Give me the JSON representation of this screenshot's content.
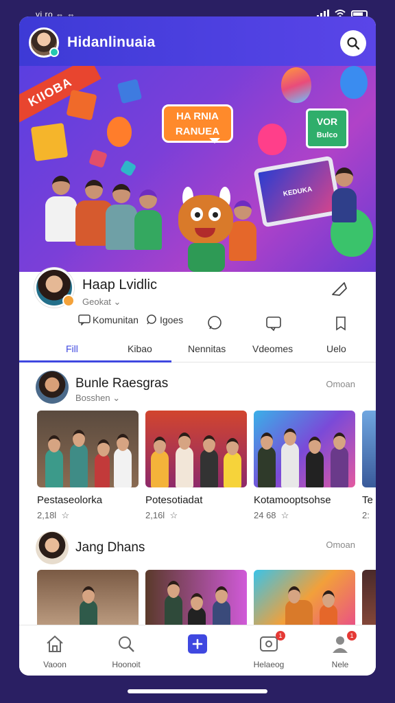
{
  "status": {
    "time": "vi ro ⇔ ⇔"
  },
  "header": {
    "title": "Hidanlinuaia"
  },
  "banner": {
    "ribbon": "KIIOBA",
    "speech_line1": "HA RNIA",
    "speech_line2": "RANUEA",
    "board_line1": "VOR",
    "board_line2": "Bulco",
    "screen": "KEDUKA"
  },
  "profile": {
    "name": "Haap Lvidlic",
    "subtitle": "Geokat",
    "actions": [
      {
        "label": "Komunitan"
      },
      {
        "label": "Igoes"
      }
    ]
  },
  "tabs": [
    {
      "label": "Fill",
      "active": true
    },
    {
      "label": "Kibao",
      "active": false
    },
    {
      "label": "Nennitas",
      "active": false
    },
    {
      "label": "Vdeomes",
      "active": false
    },
    {
      "label": "Uelo",
      "active": false
    }
  ],
  "section1": {
    "title": "Bunle Raesgras",
    "subtitle": "Bosshen",
    "more": "Omoan",
    "cards": [
      {
        "title": "Pestaseolorka",
        "meta": "2,18l",
        "rating": "☆"
      },
      {
        "title": "Potesotiadat",
        "meta": "2,16l",
        "rating": "☆"
      },
      {
        "title": "Kotamooptsohse",
        "meta": "24 68",
        "rating": "☆"
      },
      {
        "title": "Te",
        "meta": "2:",
        "rating": ""
      }
    ]
  },
  "section2": {
    "title": "Jang Dhans",
    "more": "Omoan"
  },
  "bottom_nav": [
    {
      "label": "Vaoon",
      "icon": "home-icon",
      "badge": ""
    },
    {
      "label": "Hoonoit",
      "icon": "search-icon",
      "badge": ""
    },
    {
      "label": "",
      "icon": "create-icon",
      "badge": ""
    },
    {
      "label": "Helaeog",
      "icon": "notification-icon",
      "badge": "1"
    },
    {
      "label": "Nele",
      "icon": "profile-icon",
      "badge": "1"
    }
  ],
  "colors": {
    "header": "#3d3ad6",
    "accent": "#3f48e0",
    "badge": "#e53935",
    "background": "#2a1f63"
  }
}
